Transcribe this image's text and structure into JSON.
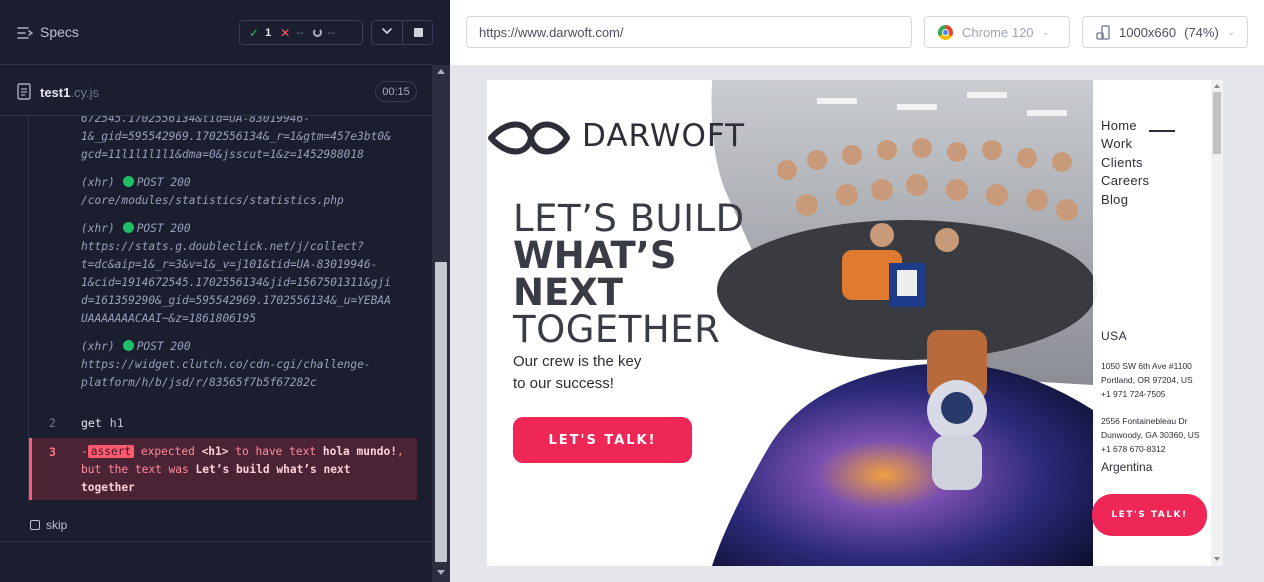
{
  "runner": {
    "specs_title": "Specs",
    "stats": {
      "passed": "1",
      "failed": "--",
      "pending": "--"
    },
    "file": {
      "name": "test1",
      "ext": ".cy.js",
      "duration": "00:15"
    },
    "log": [
      {
        "text": "672545.1702556134&tid=UA-83019946-"
      },
      {
        "text": "1&_gid=595542969.1702556134&_r=1&gtm=457e3bt0&"
      },
      {
        "text": "gcd=11l1l1l1l1&dma=0&jsscut=1&z=1452988018"
      },
      {
        "tag": "(xhr)",
        "method": "POST 200",
        "url": [
          "/core/modules/statistics/statistics.php"
        ]
      },
      {
        "tag": "(xhr)",
        "method": "POST 200",
        "url": [
          "https://stats.g.doubleclick.net/j/collect?",
          "t=dc&aip=1&_r=3&v=1&_v=j101&tid=UA-83019946-",
          "1&cid=1914672545.1702556134&jid=1567501311&gji",
          "d=161359290&_gid=595542969.1702556134&_u=YEBAA",
          "UAAAAAAACAAI~&z=1861806195"
        ]
      },
      {
        "tag": "(xhr)",
        "method": "POST 200",
        "url": [
          "https://widget.clutch.co/cdn-cgi/challenge-",
          "platform/h/b/jsd/r/83565f7b5f67282c"
        ]
      }
    ],
    "commands": {
      "get": {
        "num": "2",
        "name": "get",
        "arg": "h1"
      },
      "assert": {
        "num": "3",
        "dash": "-",
        "badge": "assert",
        "expected": "expected",
        "tag": "<h1>",
        "to_have_text": "to have text",
        "expected_value": "hola mundo!",
        "but": ", but the text was",
        "actual_value": "Let’s build what’s next together"
      }
    },
    "skip_label": "skip"
  },
  "browser": {
    "url": "https://www.darwoft.com/",
    "browser_name": "Chrome 120",
    "viewport_size": "1000x660",
    "viewport_scale": "(74%)"
  },
  "site": {
    "logo_text": "DARWOFT",
    "hero": {
      "line1": "LET’S BUILD",
      "line2": "WHAT’S",
      "line3": "NEXT",
      "line4": "TOGETHER",
      "sub1": "Our crew is the key",
      "sub2": "to our success!"
    },
    "cta_main": "LET'S TALK!",
    "nav": [
      "Home",
      "Work",
      "Clients",
      "Careers",
      "Blog"
    ],
    "usa_label": "USA",
    "address1": [
      "1050 SW 6th Ave #1100",
      "Portland, OR 97204, US",
      "+1 971 724-7505"
    ],
    "address2": [
      "2556 Fontainebleau Dr",
      "Dunwoody, GA 30360, US",
      "+1 678 670-8312"
    ],
    "argentina_label": "Argentina",
    "cta_side": "LET'S TALK!"
  }
}
